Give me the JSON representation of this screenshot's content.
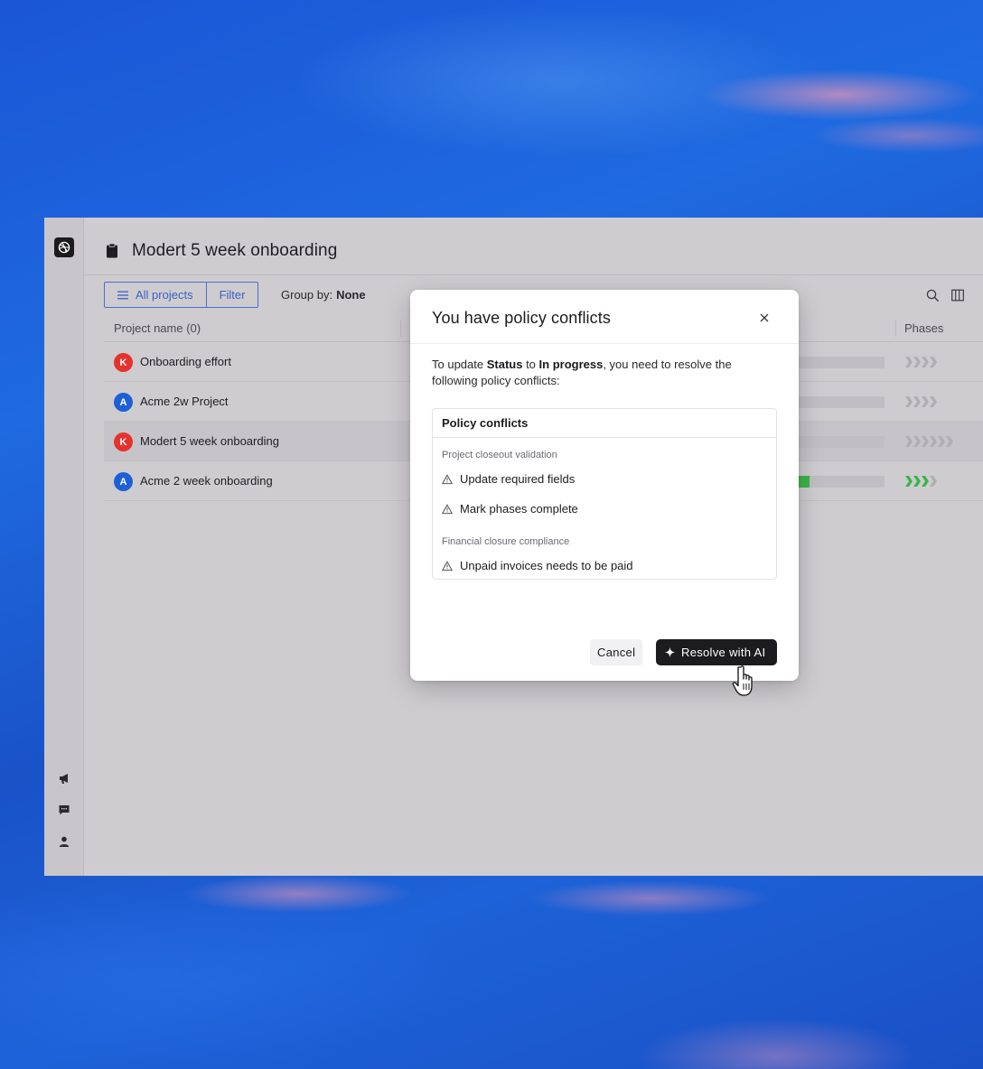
{
  "app": {
    "page_title": "Modert 5 week onboarding"
  },
  "toolbar": {
    "all_projects_label": "All projects",
    "filter_label": "Filter",
    "group_by_label": "Group by:",
    "group_by_value": "None"
  },
  "table": {
    "columns": {
      "name": "Project name (0)",
      "phases": "Phases"
    },
    "rows": [
      {
        "name": "Onboarding effort",
        "avatar_letter": "K",
        "avatar_color": "#e5322d",
        "progress": 0,
        "phases_done": 0,
        "phases_total": 4
      },
      {
        "name": "Acme 2w Project",
        "avatar_letter": "A",
        "avatar_color": "#1f5fd6",
        "progress": 0,
        "phases_done": 0,
        "phases_total": 4
      },
      {
        "name": "Modert 5 week onboarding",
        "avatar_letter": "K",
        "avatar_color": "#e5322d",
        "progress": 0,
        "phases_done": 0,
        "phases_total": 6
      },
      {
        "name": "Acme 2 week onboarding",
        "avatar_letter": "A",
        "avatar_color": "#1f5fd6",
        "progress": 0.2,
        "phases_done": 3,
        "phases_total": 4
      }
    ]
  },
  "modal": {
    "title": "You have policy conflicts",
    "desc_prefix": "To update ",
    "desc_field": "Status",
    "desc_mid": " to ",
    "desc_value": "In progress",
    "desc_suffix": ", you need to resolve the following policy conflicts:",
    "card_title": "Policy conflicts",
    "groups": [
      {
        "label": "Project closeout validation",
        "items": [
          "Update required fields",
          "Mark phases complete"
        ]
      },
      {
        "label": "Financial closure compliance",
        "items": [
          "Unpaid invoices needs to be paid"
        ]
      }
    ],
    "cancel_label": "Cancel",
    "resolve_label": "Resolve with AI"
  },
  "colors": {
    "accent": "#3a61c8",
    "progress_green": "#3cb44b",
    "danger_red": "#e5322d",
    "brand_blue": "#1f5fd6",
    "primary_button": "#1c1c1f"
  },
  "icons": {
    "logo": "dribbble-ball-icon",
    "rail": [
      "megaphone-icon",
      "chat-icon",
      "user-icon"
    ],
    "header": "clipboard-icon",
    "toolbar_right": [
      "search-icon",
      "columns-icon"
    ],
    "warning": "warning-triangle-icon",
    "close": "close-icon",
    "sparkle": "sparkle-icon"
  }
}
